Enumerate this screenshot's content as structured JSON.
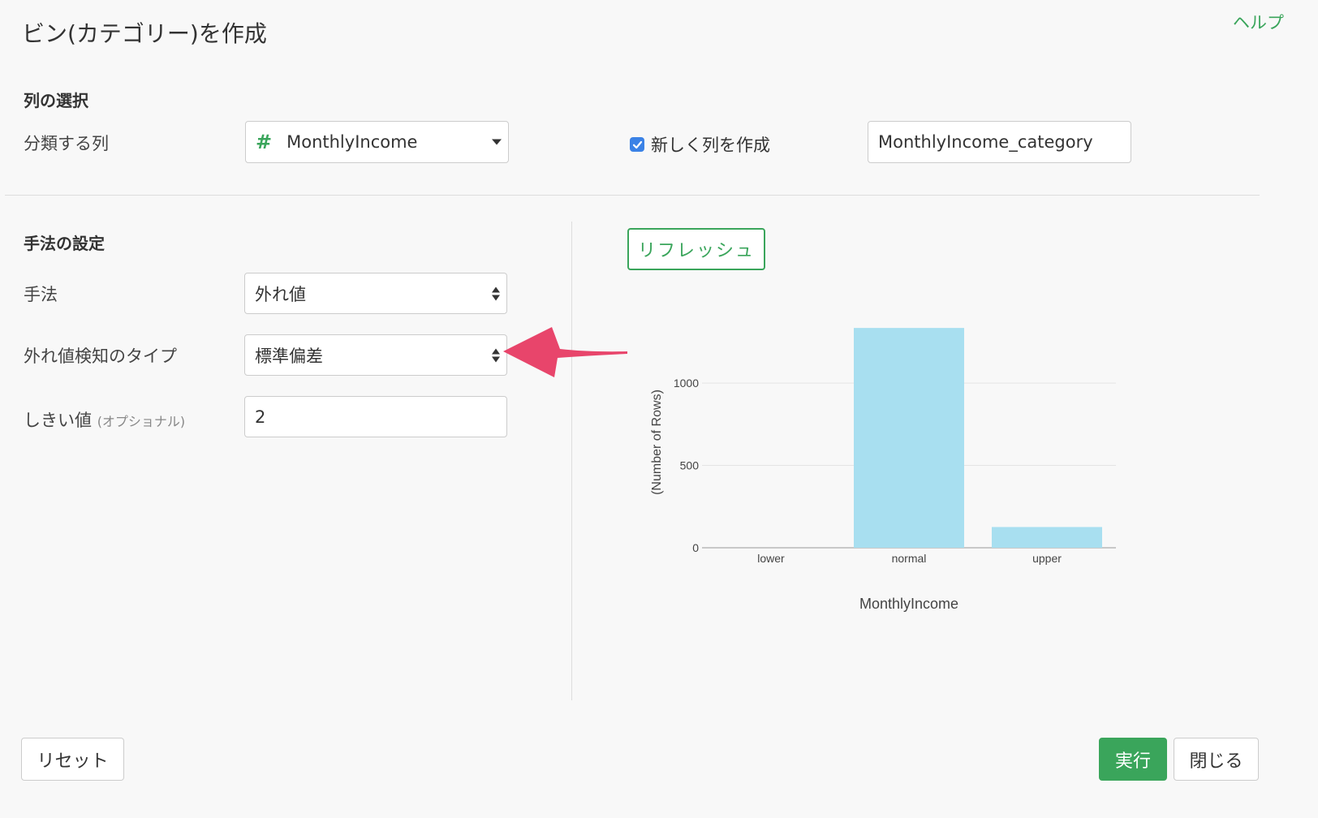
{
  "header": {
    "title": "ビン(カテゴリー)を作成",
    "help": "ヘルプ"
  },
  "column_section": {
    "heading": "列の選択",
    "label": "分類する列",
    "column_select": {
      "type_icon": "#",
      "value": "MonthlyIncome"
    },
    "new_column_checkbox": {
      "checked": true,
      "label": "新しく列を作成"
    },
    "new_column_name": "MonthlyIncome_category"
  },
  "method_section": {
    "heading": "手法の設定",
    "method": {
      "label": "手法",
      "value": "外れ値"
    },
    "outlier_type": {
      "label": "外れ値検知のタイプ",
      "value": "標準偏差"
    },
    "threshold": {
      "label": "しきい値",
      "optional": "(オプショナル)",
      "value": "2"
    }
  },
  "refresh_button": "リフレッシュ",
  "annotation": {
    "arrow_color": "#e8456b"
  },
  "chart_data": {
    "type": "bar",
    "categories": [
      "lower",
      "normal",
      "upper"
    ],
    "values": [
      0,
      1335,
      126
    ],
    "xlabel": "MonthlyIncome",
    "ylabel": "(Number of Rows)",
    "yticks": [
      0,
      500,
      1000
    ],
    "ylim": [
      0,
      1380
    ],
    "bar_color": "#a8dff0",
    "grid": true
  },
  "footer": {
    "reset": "リセット",
    "run": "実行",
    "close": "閉じる"
  },
  "colors": {
    "accent": "#3aa55b",
    "checkbox": "#3b82e6"
  }
}
